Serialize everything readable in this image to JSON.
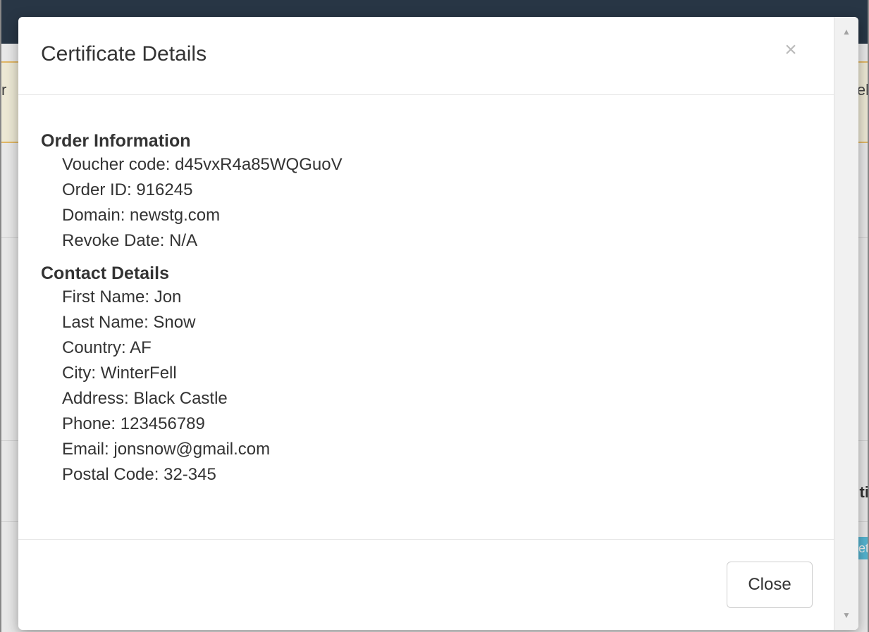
{
  "background": {
    "alert_left_text": "r",
    "alert_right_text": "el",
    "right_label_text": "ti",
    "right_button_text": "et"
  },
  "modal": {
    "title": "Certificate Details",
    "close_symbol": "×",
    "sections": [
      {
        "title": "Order Information",
        "items": [
          {
            "label": "Voucher code",
            "value": "d45vxR4a85WQGuoV"
          },
          {
            "label": "Order ID",
            "value": "916245"
          },
          {
            "label": "Domain",
            "value": "newstg.com"
          },
          {
            "label": "Revoke Date",
            "value": "N/A"
          }
        ]
      },
      {
        "title": "Contact Details",
        "items": [
          {
            "label": "First Name",
            "value": "Jon"
          },
          {
            "label": "Last Name",
            "value": "Snow"
          },
          {
            "label": "Country",
            "value": "AF"
          },
          {
            "label": "City",
            "value": "WinterFell"
          },
          {
            "label": "Address",
            "value": "Black Castle"
          },
          {
            "label": "Phone",
            "value": "123456789"
          },
          {
            "label": "Email",
            "value": "jonsnow@gmail.com"
          },
          {
            "label": "Postal Code",
            "value": "32-345"
          }
        ]
      }
    ],
    "footer": {
      "close_label": "Close"
    }
  },
  "scrollbar": {
    "up_arrow": "▲",
    "down_arrow": "▼"
  },
  "colors": {
    "topbar": "#2b3a4a",
    "alert_bg": "#fcf8e3",
    "alert_border": "#f0c36d",
    "info_button": "#5bc0de"
  }
}
